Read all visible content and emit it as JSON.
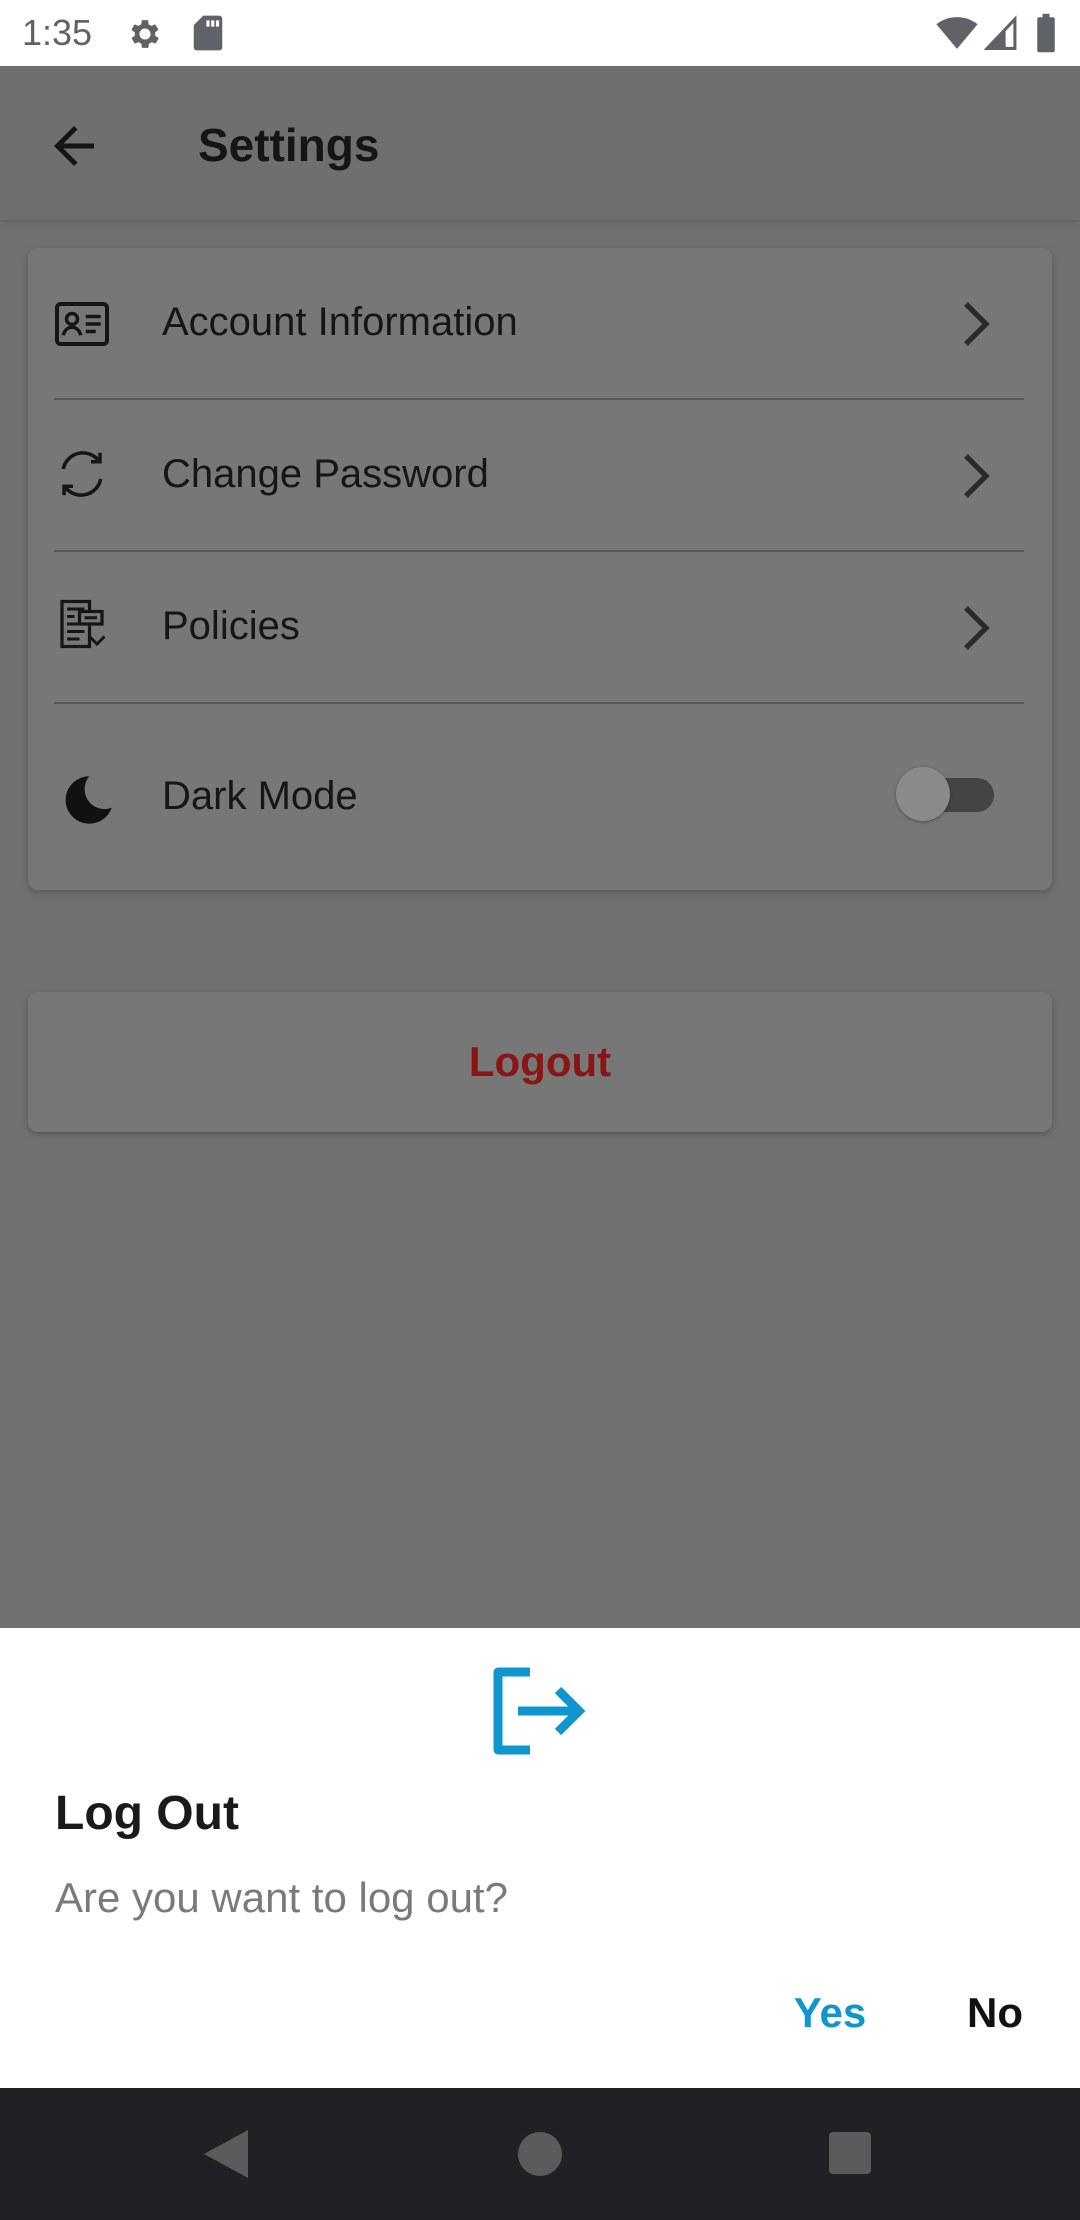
{
  "status_bar": {
    "time": "1:35",
    "icons": [
      "gear-icon",
      "sd-card-icon",
      "wifi-icon",
      "signal-icon",
      "battery-icon"
    ]
  },
  "app_bar": {
    "title": "Settings",
    "back_icon": "arrow-left-icon"
  },
  "settings": {
    "items": [
      {
        "label": "Account Information",
        "icon": "id-card-icon",
        "trailing": "chevron-right-icon"
      },
      {
        "label": "Change Password",
        "icon": "refresh-icon",
        "trailing": "chevron-right-icon"
      },
      {
        "label": "Policies",
        "icon": "document-policy-icon",
        "trailing": "chevron-right-icon"
      },
      {
        "label": "Dark Mode",
        "icon": "moon-icon",
        "trailing": "toggle",
        "toggle_on": false
      }
    ]
  },
  "logout_button": {
    "label": "Logout",
    "color": "#8b1414"
  },
  "dialog": {
    "icon": "logout-icon",
    "title": "Log Out",
    "message": "Are you want to log out?",
    "yes_label": "Yes",
    "no_label": "No",
    "accent_color": "#0f96cf"
  },
  "nav_bar": {
    "icons": [
      "nav-back-icon",
      "nav-home-icon",
      "nav-recents-icon"
    ]
  }
}
